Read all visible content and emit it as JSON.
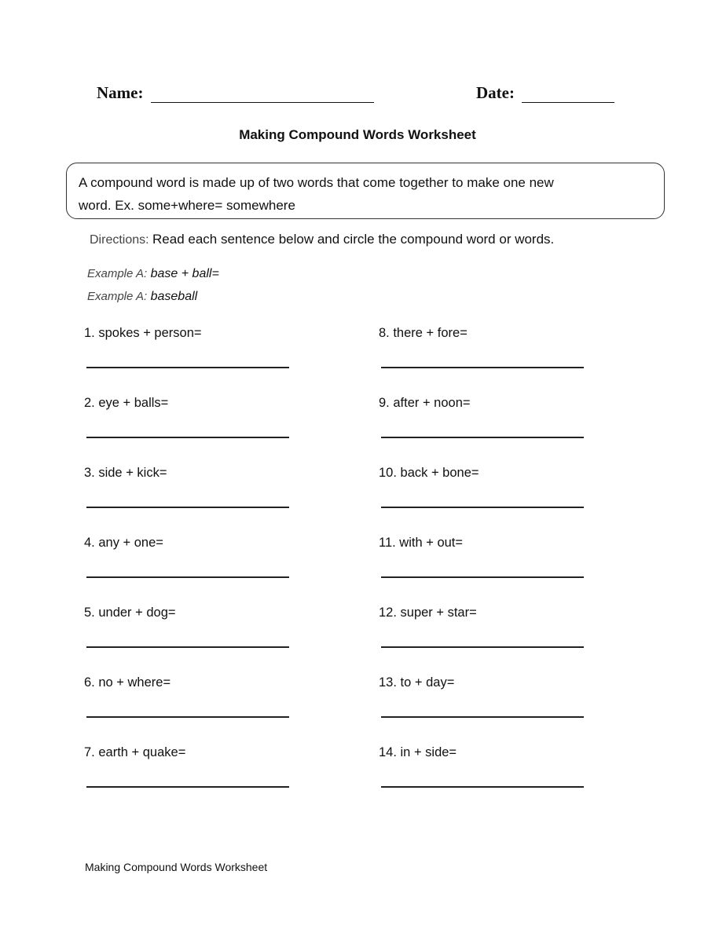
{
  "header": {
    "name_label": "Name:",
    "date_label": "Date:"
  },
  "title": "Making Compound Words Worksheet",
  "definition_box": {
    "line1": "A compound word is made up of two words that come together to make one new",
    "line2": "word. Ex. some+where= somewhere"
  },
  "directions": {
    "label": "Directions:",
    "text": "Read each sentence below and circle the compound word or words."
  },
  "examples": [
    {
      "label": "Example A:",
      "text": "base + ball="
    },
    {
      "label": "Example A:",
      "text": "baseball"
    }
  ],
  "left_items": [
    "1. spokes + person=",
    "2. eye + balls=",
    "3. side + kick=",
    "4. any + one=",
    "5. under + dog=",
    "6. no + where=",
    "7. earth + quake="
  ],
  "right_items": [
    "8. there + fore=",
    "9. after + noon=",
    "10. back + bone=",
    "11. with + out=",
    "12. super + star=",
    "13. to + day=",
    "14. in + side="
  ],
  "footer": "Making Compound Words Worksheet"
}
